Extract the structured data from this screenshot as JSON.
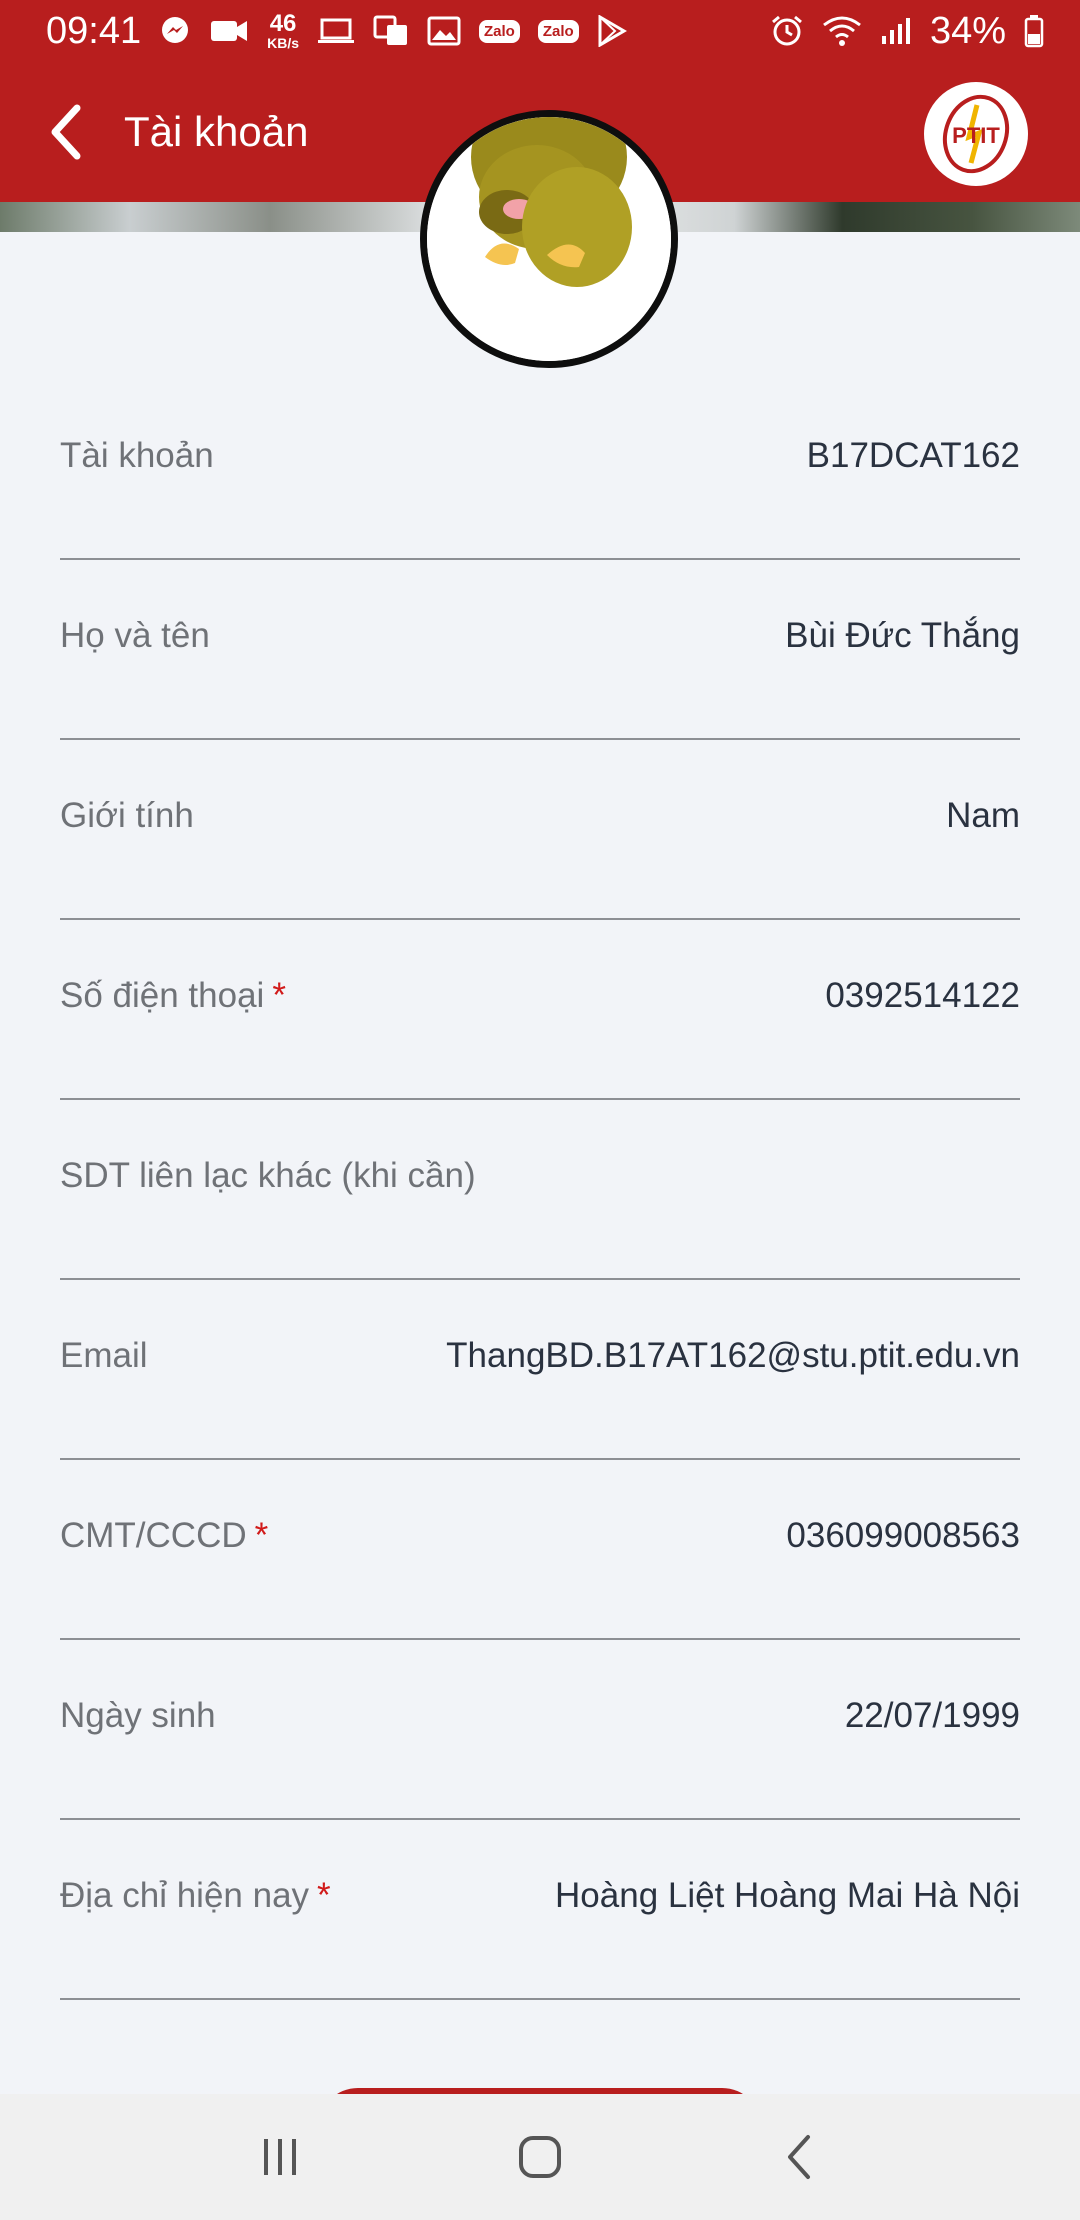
{
  "status_bar": {
    "time": "09:41",
    "net_speed": "46",
    "net_unit": "KB/s",
    "zalo_1": "Zalo",
    "zalo_2": "Zalo",
    "battery": "34%",
    "icons": [
      "messenger-icon",
      "video-icon",
      "laptop-icon",
      "translate-icon",
      "gallery-icon",
      "zalo-icon",
      "zalo-icon",
      "play-store-icon",
      "alarm-icon",
      "wifi-icon",
      "signal-icon",
      "battery-icon"
    ]
  },
  "app_bar": {
    "title": "Tài khoản",
    "logo_text": "PTIT"
  },
  "colors": {
    "brand_red": "#b81e1e",
    "background": "#f2f4f8",
    "required_star": "#d11a1a"
  },
  "fields": [
    {
      "label": "Tài khoản",
      "required": false,
      "value": "B17DCAT162"
    },
    {
      "label": "Họ và tên",
      "required": false,
      "value": "Bùi Đức Thắng"
    },
    {
      "label": "Giới tính",
      "required": false,
      "value": "Nam"
    },
    {
      "label": "Số điện thoại",
      "required": true,
      "value": "0392514122"
    },
    {
      "label": "SDT liên lạc khác (khi cần)",
      "required": false,
      "value": ""
    },
    {
      "label": "Email",
      "required": false,
      "value": "ThangBD.B17AT162@stu.ptit.edu.vn"
    },
    {
      "label": "CMT/CCCD",
      "required": true,
      "value": "036099008563"
    },
    {
      "label": "Ngày sinh",
      "required": false,
      "value": "22/07/1999"
    },
    {
      "label": "Địa chỉ hiện nay",
      "required": true,
      "value": "Hoàng Liệt Hoàng Mai Hà Nội"
    }
  ],
  "required_mark": "*"
}
